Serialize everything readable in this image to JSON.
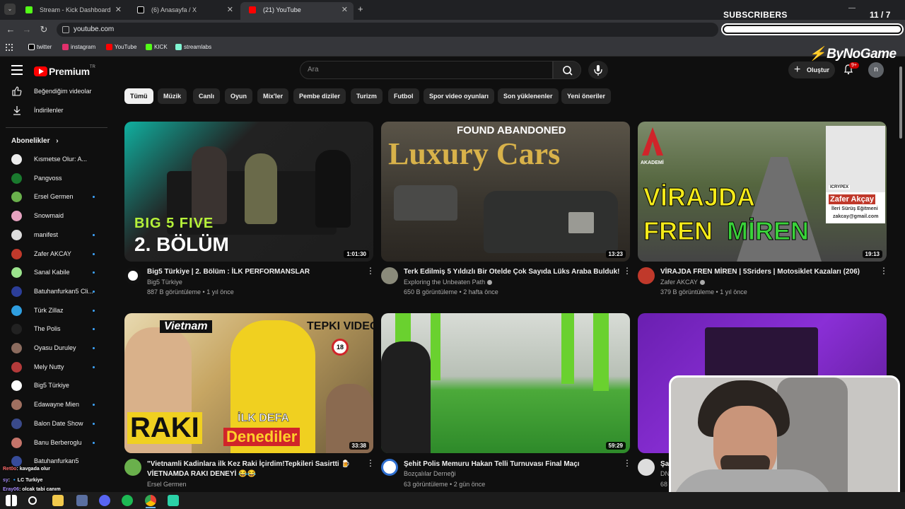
{
  "browser": {
    "tabs": [
      {
        "label": "Stream - Kick Dashboard",
        "color": "#53fc18"
      },
      {
        "label": "(6) Anasayfa / X",
        "color": "#ffffff"
      },
      {
        "label": "(21) YouTube",
        "color": "#ff0000"
      }
    ],
    "url": "youtube.com",
    "bookmarks": [
      {
        "label": "twitter",
        "color": "#ffffff"
      },
      {
        "label": "instagram",
        "color": "#e1306c"
      },
      {
        "label": "YouTube",
        "color": "#ff0000"
      },
      {
        "label": "KICK",
        "color": "#53fc18"
      },
      {
        "label": "streamlabs",
        "color": "#80f5d2"
      }
    ]
  },
  "overlay": {
    "subscribers_title": "SUBSCRIBERS",
    "subscribers_count": "11 / 7",
    "brand": "ByNoGame"
  },
  "youtube": {
    "logo_word": "Premium",
    "logo_tr": "TR",
    "search_placeholder": "Ara",
    "create_label": "Oluştur",
    "notif_badge": "9+",
    "avatar_letter": "n"
  },
  "sidebar": {
    "links": [
      "Beğendiğim videolar",
      "İndirilenler"
    ],
    "subs_heading": "Abonelikler",
    "subscriptions": [
      {
        "name": "Kısmetse Olur: A...",
        "color": "#ececec",
        "dot": false
      },
      {
        "name": "Pangvoss",
        "color": "#1a7a2e",
        "dot": false
      },
      {
        "name": "Ersel Germen",
        "color": "#6ab04c",
        "dot": true
      },
      {
        "name": "Snowmaid",
        "color": "#e6a2c0",
        "dot": false
      },
      {
        "name": "manifest",
        "color": "#dddddd",
        "dot": true
      },
      {
        "name": "Zafer AKCAY",
        "color": "#c0392b",
        "dot": true
      },
      {
        "name": "Sanal Kabile",
        "color": "#9be38d",
        "dot": true
      },
      {
        "name": "Batuhanfurkan5 Cli...",
        "color": "#2c3e99",
        "dot": true
      },
      {
        "name": "Türk Zillaz",
        "color": "#2f9ee0",
        "dot": true
      },
      {
        "name": "The Polis",
        "color": "#222222",
        "dot": true
      },
      {
        "name": "Oyasu Duruley",
        "color": "#8b6b5e",
        "dot": true
      },
      {
        "name": "Mely Nutty",
        "color": "#b33a3a",
        "dot": true
      },
      {
        "name": "Big5 Türkiye",
        "color": "#ffffff",
        "dot": false
      },
      {
        "name": "Edawayne Mien",
        "color": "#a07060",
        "dot": true
      },
      {
        "name": "Balon Date Show",
        "color": "#3a4a8a",
        "dot": true
      },
      {
        "name": "Banu Berberoglu",
        "color": "#c4746a",
        "dot": true
      },
      {
        "name": "Batuhanfurkan5",
        "color": "#374c9a",
        "dot": false
      }
    ]
  },
  "chips": [
    "Tümü",
    "Müzik",
    "Canlı",
    "Oyun",
    "Mix'ler",
    "Pembe diziler",
    "Turizm",
    "Futbol",
    "Spor video oyunları",
    "Son yüklenenler",
    "Yeni öneriler"
  ],
  "videos": [
    {
      "title": "Big5 Türkiye | 2. Bölüm : İLK PERFORMANSLAR",
      "title2": "",
      "channel": "Big5 Türkiye",
      "verified": false,
      "meta": "887 B görüntüleme • 1 yıl önce",
      "duration": "1:01:30",
      "ov1": "BIG 5 FIVE",
      "ov2": "2. BÖLÜM",
      "avatar_color": "#ffffff"
    },
    {
      "title": "Terk Edilmiş 5 Yıldızlı Bir Otelde Çok Sayıda Lüks Araba Bulduk!",
      "title2": "",
      "channel": "Exploring the Unbeaten Path",
      "verified": true,
      "meta": "650 B görüntüleme • 2 hafta önce",
      "duration": "13:23",
      "ov1": "FOUND ABANDONED",
      "ov2": "Luxury Cars",
      "avatar_color": "#8a8a7a"
    },
    {
      "title": "VİRAJDA FREN MİREN | 5Sriders | Motosiklet Kazaları (206)",
      "title2": "",
      "channel": "Zafer AKCAY",
      "verified": true,
      "meta": "379 B görüntüleme • 1 yıl önce",
      "duration": "19:13",
      "ov1": "VİRAJDA",
      "ov2": "FREN",
      "ov3": "MİREN",
      "ov4": "Zafer Akçay",
      "ov5": "İleri Sürüş Eğitmeni",
      "ov6": "zakcay@gmail.com",
      "ov7": "AKADEMİ",
      "ov8": "ICRYPEX",
      "avatar_color": "#c0392b"
    },
    {
      "title": "\"Vietnamli Kadinlara ilk Kez Raki İçirdim!Tepkileri Sasirtti 🍺",
      "title2": "VİETNAMDA RAKI DENEYİ 😂😂",
      "channel": "Ersel Germen",
      "verified": false,
      "meta": "",
      "duration": "33:38",
      "ov1": "Vietnam",
      "ov2": "TEPKI VIDEO",
      "ov3": "RAKI",
      "ov4": "İLK DEFA",
      "ov5": "Denediler",
      "avatar_color": "#6ab04c"
    },
    {
      "title": "Şehit Polis Memuru Hakan Telli Turnuvası Final Maçı",
      "title2": "",
      "channel": "Bozçalılar Derneği",
      "verified": false,
      "meta": "63 görüntüleme • 2 gün önce",
      "duration": "59:29",
      "avatar_color": "#2f6fd0"
    },
    {
      "title": "Şa",
      "title2": "",
      "channel": "DN",
      "verified": false,
      "meta": "68",
      "duration": "",
      "avatar_color": "#dddddd"
    }
  ],
  "chat": [
    {
      "user": "Ret0o",
      "msg": ": kavgada olur",
      "color": "#ff6b6b"
    },
    {
      "user": "sy",
      "msg": ": 🔹LC Turkiye",
      "color": "#a78bfa"
    },
    {
      "user": "Eray06",
      "msg": ": olcak tabi canım",
      "color": "#a78bfa"
    }
  ],
  "taskbar": [
    "windows-icon",
    "search-icon",
    "files-icon",
    "app-icon",
    "discord-icon",
    "spotify-icon",
    "chrome-icon",
    "kick-icon"
  ]
}
